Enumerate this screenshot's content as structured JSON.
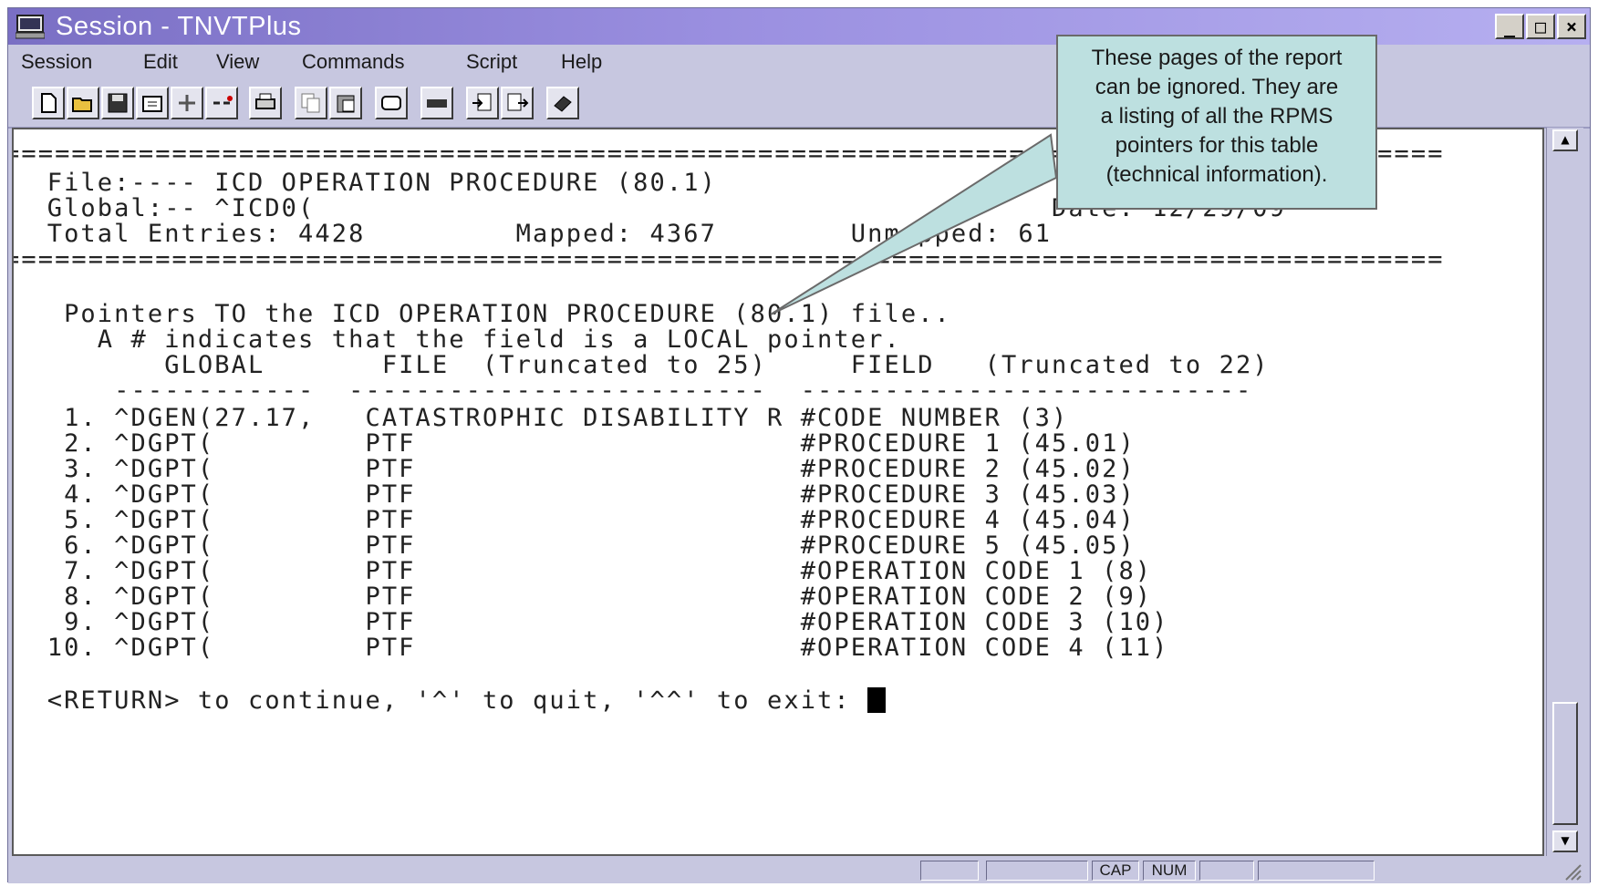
{
  "window": {
    "title": "Session - TNVTPlus",
    "min_label": "_",
    "max_label": "□",
    "close_label": "×"
  },
  "menu": [
    "Session",
    "Edit",
    "View",
    "Commands",
    "Script",
    "Help"
  ],
  "toolbar_icons": [
    "new-icon",
    "open-icon",
    "save-icon",
    "properties-icon",
    "connect-icon",
    "disconnect-icon",
    "print-icon",
    "copy-icon",
    "paste-icon",
    "screen-icon",
    "keyboard-icon",
    "send-icon",
    "receive-icon",
    "book-icon"
  ],
  "terminal": {
    "separator_top": "======================================================================================",
    "file_line": "  File:---- ICD OPERATION PROCEDURE (80.1)",
    "global_line": "  Global:-- ^ICD0(                                            Date: 12/29/09",
    "total_line": "  Total Entries: 4428         Mapped: 4367        Unmapped: 61",
    "separator_bottom": "======================================================================================",
    "pointers_line": "   Pointers TO the ICD OPERATION PROCEDURE (80.1) file..",
    "local_line": "     A # indicates that the field is a LOCAL pointer.",
    "header_line": "         GLOBAL       FILE  (Truncated to 25)     FIELD   (Truncated to 22)",
    "dash_line": "      ------------  -------------------------  ---------------------------",
    "rows": [
      "   1. ^DGEN(27.17,   CATASTROPHIC DISABILITY R #CODE NUMBER (3)",
      "   2. ^DGPT(         PTF                       #PROCEDURE 1 (45.01)",
      "   3. ^DGPT(         PTF                       #PROCEDURE 2 (45.02)",
      "   4. ^DGPT(         PTF                       #PROCEDURE 3 (45.03)",
      "   5. ^DGPT(         PTF                       #PROCEDURE 4 (45.04)",
      "   6. ^DGPT(         PTF                       #PROCEDURE 5 (45.05)",
      "   7. ^DGPT(         PTF                       #OPERATION CODE 1 (8)",
      "   8. ^DGPT(         PTF                       #OPERATION CODE 2 (9)",
      "   9. ^DGPT(         PTF                       #OPERATION CODE 3 (10)",
      "  10. ^DGPT(         PTF                       #OPERATION CODE 4 (11)"
    ],
    "prompt": "  <RETURN> to continue, '^' to quit, '^^' to exit: "
  },
  "callout": {
    "lines": [
      "These pages of the report",
      "can be ignored. They are",
      "a listing of all the RPMS",
      "pointers for this table",
      "(technical information)."
    ]
  },
  "status": {
    "cap": "CAP",
    "num": "NUM"
  },
  "colors": {
    "title_gradient_start": "#7a6fc4",
    "chrome": "#c7c7e0",
    "callout_bg": "#bde0e0"
  }
}
